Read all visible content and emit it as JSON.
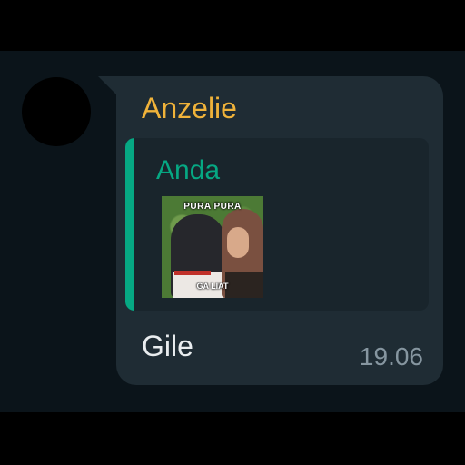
{
  "message": {
    "sender_name": "Anzelie",
    "quoted": {
      "author": "Anda",
      "sticker": {
        "top_text": "PURA PURA",
        "bottom_text": "GA LIAT"
      }
    },
    "text": "Gile",
    "time": "19.06"
  },
  "colors": {
    "sender_name": "#f0b33a",
    "quote_accent": "#06a883",
    "bubble": "#1f2c34",
    "chat_background": "#0b141a"
  }
}
